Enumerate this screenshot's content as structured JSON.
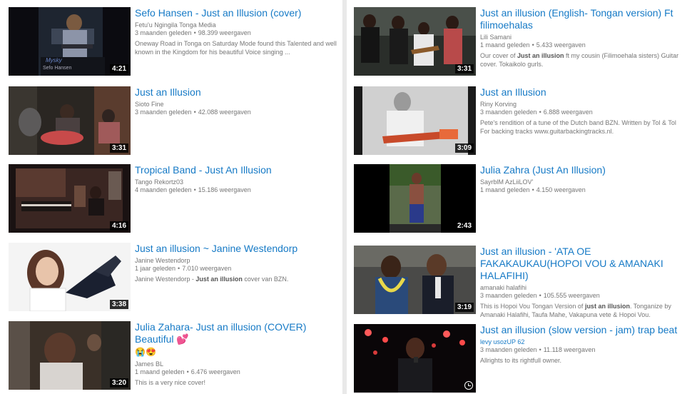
{
  "left": [
    {
      "title": "Sefo Hansen - Just an Illusion (cover)",
      "channel": "Fetu'u Ngingila Tonga Media",
      "age": "3 maanden geleden",
      "views": "98.399 weergaven",
      "desc_pre": "Oneway Road in Tonga on Saturday Mode found this Talented and well known in the Kingdom for his beautiful Voice singing ...",
      "desc_bold": "",
      "desc_post": "",
      "duration": "4:21"
    },
    {
      "title": "Just an Illusion",
      "channel": "Sioto Fine",
      "age": "3 maanden geleden",
      "views": "42.088 weergaven",
      "desc_pre": "",
      "desc_bold": "",
      "desc_post": "",
      "duration": "3:31"
    },
    {
      "title": "Tropical Band - Just An Illusion",
      "channel": "Tango Rekortz03",
      "age": "4 maanden geleden",
      "views": "15.186 weergaven",
      "desc_pre": "",
      "desc_bold": "",
      "desc_post": "",
      "duration": "4:16"
    },
    {
      "title": "Just an illusion ~ Janine Westendorp",
      "channel": "Janine Westendorp",
      "age": "1 jaar geleden",
      "views": "7.010 weergaven",
      "desc_pre": "Janine Westendorp - ",
      "desc_bold": "Just an illusion",
      "desc_post": " cover van BZN.",
      "duration": "3:38"
    },
    {
      "title": "Julia Zahara- Just an illusion (COVER) Beautiful 💕",
      "title2": "😭😍",
      "channel": "James BL",
      "age": "1 maand geleden",
      "views": "6.476 weergaven",
      "desc_pre": "This is a very nice cover!",
      "desc_bold": "",
      "desc_post": "",
      "duration": "3:20"
    }
  ],
  "right": [
    {
      "title": "Just an illusion (English- Tongan version) Ft filimoehalas",
      "channel": "Lili Samani",
      "age": "1 maand geleden",
      "views": "5.433 weergaven",
      "desc_pre": "Our cover of ",
      "desc_bold": "Just an illusion",
      "desc_post": " ft my cousin (Filimoehala sisters) Guitar cover. Tokaikolo gurls.",
      "duration": "3:31"
    },
    {
      "title": "Just an Illusion",
      "channel": "Riny Korving",
      "age": "3 maanden geleden",
      "views": "6.888 weergaven",
      "desc_pre": "Pete's rendition of a tune of the Dutch band BZN. Written by Tol & Tol For backing tracks www.guitarbackingtracks.nl.",
      "desc_bold": "",
      "desc_post": "",
      "duration": "3:09"
    },
    {
      "title": "Julia Zahra (Just An Illusion)",
      "channel": "SayrblM AzLiiLOV'",
      "age": "1 maand geleden",
      "views": "4.150 weergaven",
      "desc_pre": "",
      "desc_bold": "",
      "desc_post": "",
      "duration": "2:43"
    },
    {
      "title": "Just an illusion - 'ATA OE FAKAKAUKAU(HOPOI VOU & AMANAKI HALAFIHI)",
      "channel": "amanaki halafihi",
      "age": "3 maanden geleden",
      "views": "105.555 weergaven",
      "desc_pre": "This is Hopoi Vou Tongan Version of ",
      "desc_bold": "just an illusion",
      "desc_post": ". Tonganize by Amanaki Halafihi, Taufa Mahe, Vakapuna vete & Hopoi Vou.",
      "duration": "3:19"
    },
    {
      "title": "Just an illusion (slow version - jam) trap beat",
      "channel": "levy usozUP 62",
      "age": "3 maanden geleden",
      "views": "11.118 weergaven",
      "desc_pre": "Allrights to its rightfull owner.",
      "desc_bold": "",
      "desc_post": "",
      "duration": ""
    }
  ],
  "thumb_text": {
    "left0_line1": "Mysky",
    "left0_line2": "Sefo Hansen"
  },
  "colors": {
    "title": "#167ac6",
    "meta": "#767676",
    "page_bg": "#e9e9e9"
  }
}
